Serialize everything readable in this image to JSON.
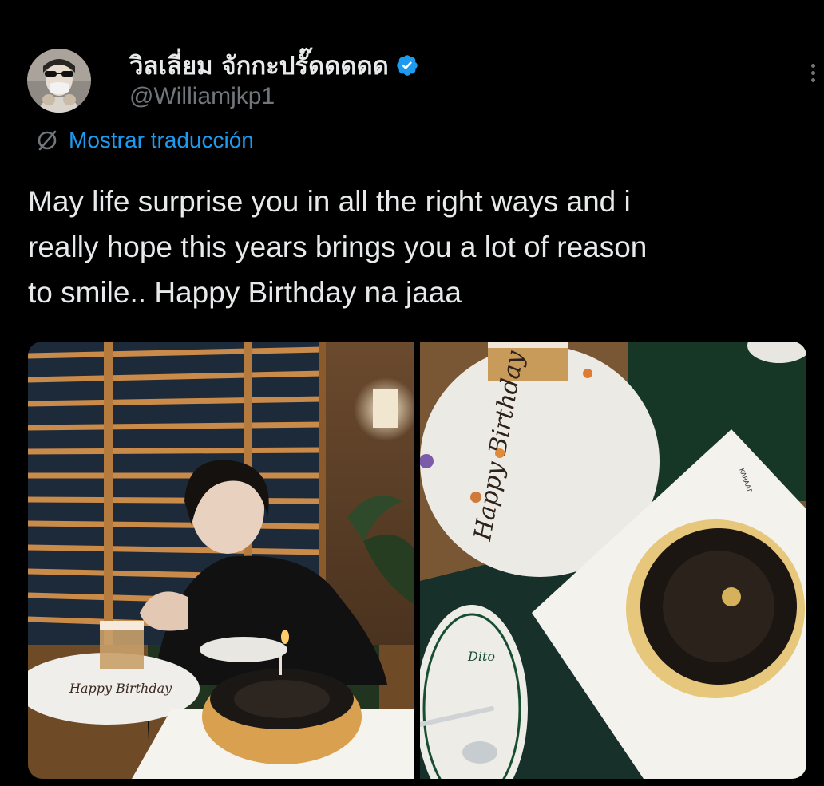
{
  "tweet": {
    "author": {
      "display_name": "วิลเลี่ยม จักกะปรั๊ดดดดด",
      "handle": "@Williamjkp1",
      "verified": true,
      "verified_color": "#1d9bf0"
    },
    "translate_label": "Mostrar traducción",
    "text": "May life surprise you in all the right ways and i\nreally hope this years brings you a lot of reason\nto smile.. Happy Birthday na jaaa",
    "media": [
      {
        "label": "photo-1",
        "plate_text": "Happy Birthday"
      },
      {
        "label": "photo-2",
        "plate_text": "Happy Birthday",
        "box_text": "KARAAT",
        "small_plate_text": "Dito"
      }
    ]
  },
  "icons": {
    "verified": "verified-badge-icon",
    "more": "more-options-icon",
    "translate": "translate-icon"
  },
  "colors": {
    "background": "#000000",
    "text": "#e7e9ea",
    "secondary": "#71767b",
    "link": "#1d9bf0"
  }
}
